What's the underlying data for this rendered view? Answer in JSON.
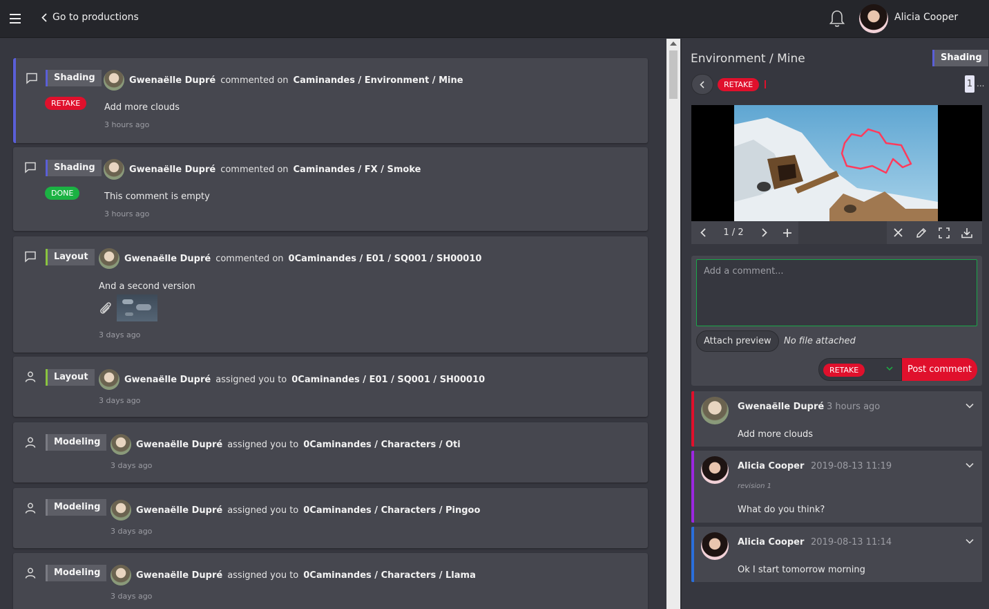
{
  "topbar": {
    "back_label": "Go to productions",
    "user_name": "Alicia Cooper"
  },
  "feed": [
    {
      "kind": "comment",
      "task": "Shading",
      "task_color": "#5a5fd8",
      "status": "RETAKE",
      "author": "Gwenaëlle Dupré",
      "verb": "commented on",
      "target": "Caminandes / Environment / Mine",
      "text": "Add more clouds",
      "ago": "3 hours ago",
      "selected": true
    },
    {
      "kind": "comment",
      "task": "Shading",
      "task_color": "#5a5fd8",
      "status": "DONE",
      "author": "Gwenaëlle Dupré",
      "verb": "commented on",
      "target": "Caminandes / FX / Smoke",
      "text": "This comment is empty",
      "ago": "3 hours ago"
    },
    {
      "kind": "comment",
      "task": "Layout",
      "task_color": "#8ac43f",
      "author": "Gwenaëlle Dupré",
      "verb": "commented on",
      "target": "0Caminandes / E01 / SQ001 / SH00010",
      "text": "And a second version",
      "ago": "3 days ago"
    },
    {
      "kind": "assignment",
      "task": "Layout",
      "task_color": "#8ac43f",
      "author": "Gwenaëlle Dupré",
      "verb": "assigned you to",
      "target": "0Caminandes / E01 / SQ001 / SH00010",
      "ago": "3 days ago"
    },
    {
      "kind": "assignment",
      "task": "Modeling",
      "task_color": "#7a7b83",
      "author": "Gwenaëlle Dupré",
      "verb": "assigned you to",
      "target": "0Caminandes / Characters / Oti",
      "ago": "3 days ago"
    },
    {
      "kind": "assignment",
      "task": "Modeling",
      "task_color": "#7a7b83",
      "author": "Gwenaëlle Dupré",
      "verb": "assigned you to",
      "target": "0Caminandes / Characters / Pingoo",
      "ago": "3 days ago"
    },
    {
      "kind": "assignment",
      "task": "Modeling",
      "task_color": "#7a7b83",
      "author": "Gwenaëlle Dupré",
      "verb": "assigned you to",
      "target": "0Caminandes / Characters / Llama",
      "ago": "3 days ago"
    }
  ],
  "panel": {
    "title": "Environment / Mine",
    "task": "Shading",
    "status": "RETAKE",
    "revision_count": "1",
    "revision_more": "...",
    "frame_counter": "1 / 2",
    "comment_placeholder": "Add a comment...",
    "attach_label": "Attach preview",
    "no_file_label": "No file attached",
    "select_status": "RETAKE",
    "post_label": "Post comment",
    "threads": [
      {
        "author": "Gwenaëlle Dupré",
        "time": "3 hours ago",
        "text": "Add more clouds",
        "color": "#e0102c"
      },
      {
        "author": "Alicia Cooper",
        "time": "2019-08-13 11:19",
        "revision": "revision 1",
        "text": "What do you think?",
        "color": "#9c27e0"
      },
      {
        "author": "Alicia Cooper",
        "time": "2019-08-13 11:14",
        "text": "Ok I start tomorrow morning",
        "color": "#2a6fdb"
      }
    ]
  }
}
